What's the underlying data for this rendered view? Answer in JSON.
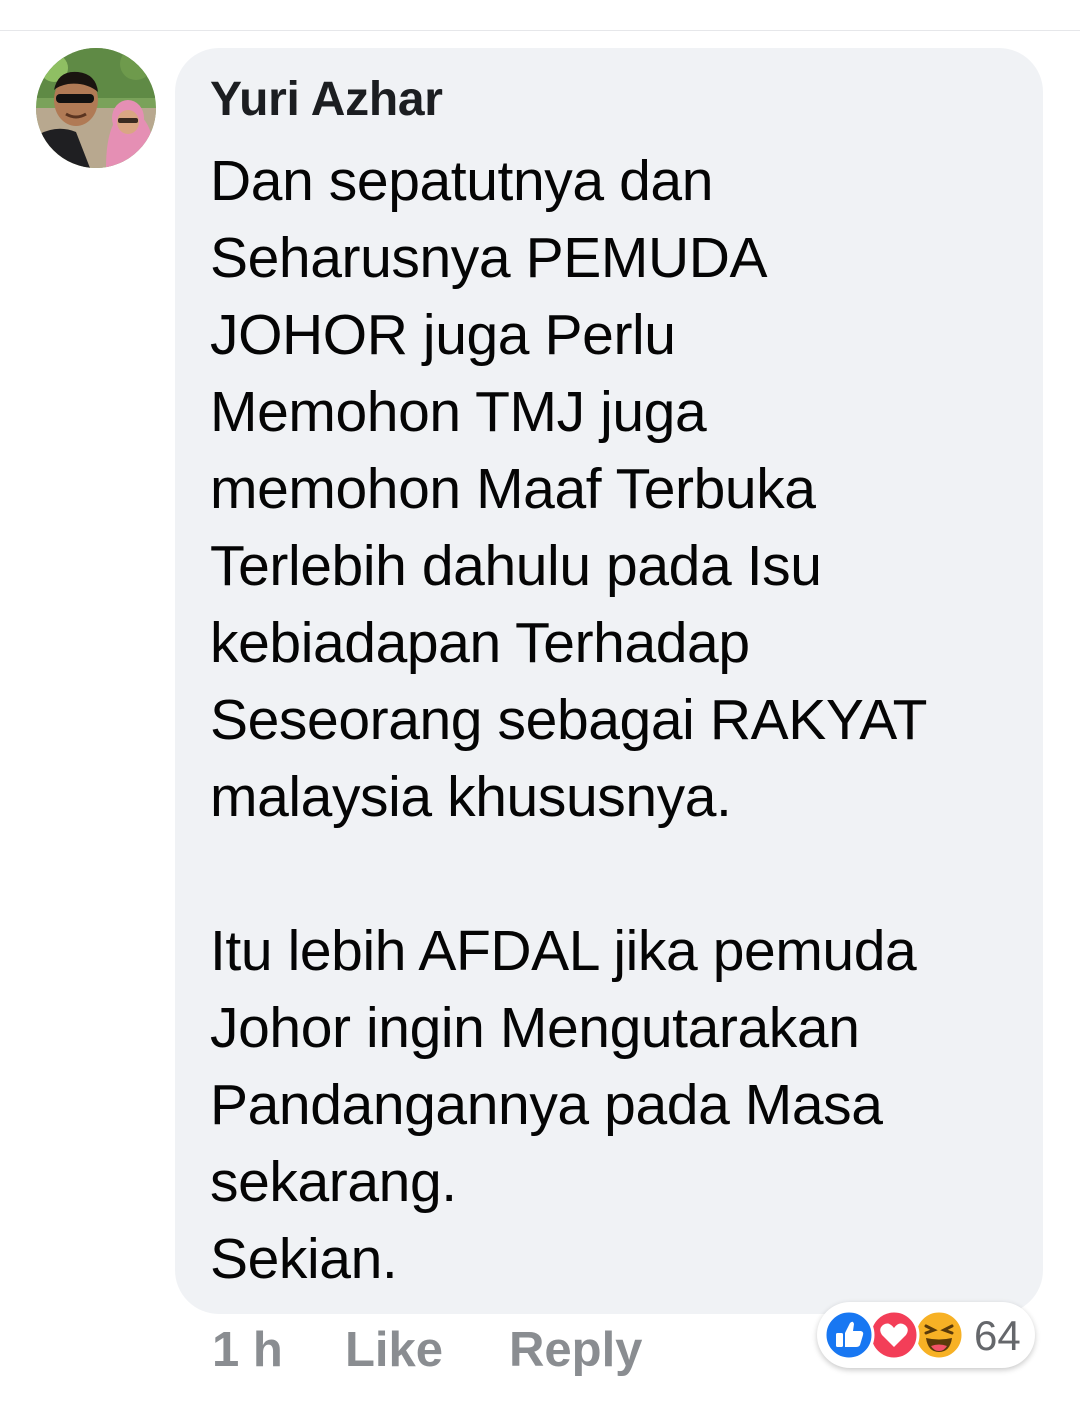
{
  "comment": {
    "author": "Yuri Azhar",
    "text": "Dan sepatutnya dan\nSeharusnya  PEMUDA\nJOHOR juga Perlu\nMemohon TMJ juga\nmemohon Maaf Terbuka\nTerlebih dahulu pada Isu\nkebiadapan Terhadap\nSeseorang sebagai RAKYAT\nmalaysia khususnya.\n\nItu lebih AFDAL jika pemuda\nJohor ingin Mengutarakan\nPandangannya pada Masa\nsekarang.\nSekian.",
    "time": "1 h",
    "like_label": "Like",
    "reply_label": "Reply"
  },
  "reactions": {
    "icons": [
      "like-icon",
      "love-icon",
      "haha-icon"
    ],
    "count": "64"
  },
  "colors": {
    "bubble": "#f0f2f5",
    "action_text": "#8a8d91",
    "like_blue": "#1877f2",
    "love_red": "#f33e58",
    "haha_yellow": "#f7b125"
  }
}
